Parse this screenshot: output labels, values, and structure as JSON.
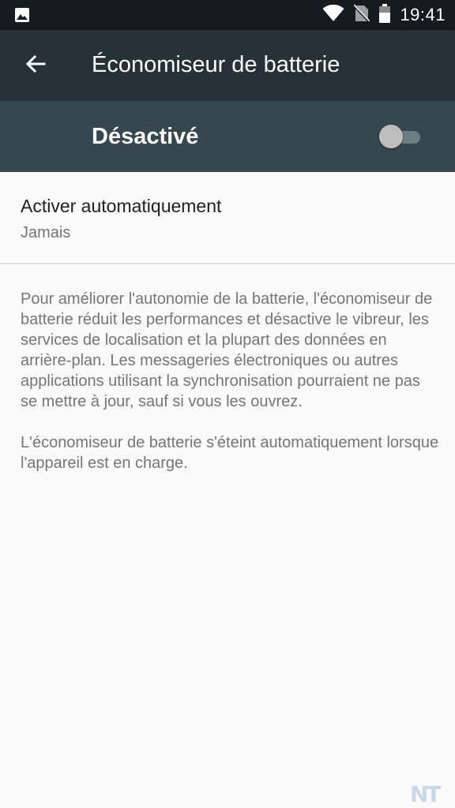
{
  "status_bar": {
    "time": "19:41",
    "icons": [
      "image-icon",
      "wifi-icon",
      "no-sim-icon",
      "battery-icon"
    ]
  },
  "app_bar": {
    "title": "Économiseur de batterie",
    "back_icon": "arrow-back-icon"
  },
  "master_switch": {
    "label": "Désactivé",
    "state": "off"
  },
  "preference": {
    "title": "Activer automatiquement",
    "summary": "Jamais"
  },
  "description": {
    "paragraph1": "Pour améliorer l'autonomie de la batterie, l'économiseur de batterie réduit les performances et désactive le vibreur, les services de localisation et la plupart des données en arrière-plan. Les messageries électroniques ou autres applications utilisant la synchronisation pourraient ne pas se mettre à jour, sauf si vous les ouvrez.",
    "paragraph2": "L'économiseur de batterie s'éteint automatiquement lorsque l'appareil est en charge."
  },
  "watermark": {
    "text": "NT"
  },
  "colors": {
    "status_bar": "#151b1f",
    "app_bar": "#263238",
    "master_bar": "#37474f",
    "background": "#fafafa",
    "primary_text": "#212121",
    "secondary_text": "#757575"
  }
}
